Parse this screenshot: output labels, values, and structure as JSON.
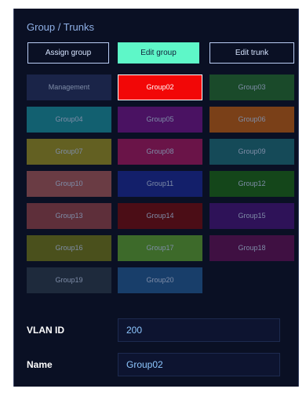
{
  "panel": {
    "title": "Group / Trunks"
  },
  "modes": {
    "assign_label": "Assign group",
    "edit_label": "Edit group",
    "trunk_label": "Edit trunk",
    "active": "Edit group"
  },
  "groups": [
    {
      "label": "Management",
      "color": "#1a2448",
      "selected": false
    },
    {
      "label": "Group02",
      "color": "#f20707",
      "selected": true
    },
    {
      "label": "Group03",
      "color": "#1a4a2a",
      "selected": false
    },
    {
      "label": "Group04",
      "color": "#126070",
      "selected": false
    },
    {
      "label": "Group05",
      "color": "#4a1262",
      "selected": false
    },
    {
      "label": "Group06",
      "color": "#7a4018",
      "selected": false
    },
    {
      "label": "Group07",
      "color": "#636022",
      "selected": false
    },
    {
      "label": "Group08",
      "color": "#6a1448",
      "selected": false
    },
    {
      "label": "Group09",
      "color": "#154a58",
      "selected": false
    },
    {
      "label": "Group10",
      "color": "#6a3c44",
      "selected": false
    },
    {
      "label": "Group11",
      "color": "#131f6a",
      "selected": false
    },
    {
      "label": "Group12",
      "color": "#14461a",
      "selected": false
    },
    {
      "label": "Group13",
      "color": "#5e2f3a",
      "selected": false
    },
    {
      "label": "Group14",
      "color": "#4b0d16",
      "selected": false
    },
    {
      "label": "Group15",
      "color": "#2e1258",
      "selected": false
    },
    {
      "label": "Group16",
      "color": "#4a501c",
      "selected": false
    },
    {
      "label": "Group17",
      "color": "#3d6a2a",
      "selected": false
    },
    {
      "label": "Group18",
      "color": "#3f1042",
      "selected": false
    },
    {
      "label": "Group19",
      "color": "#1e2a3c",
      "selected": false
    },
    {
      "label": "Group20",
      "color": "#183e6a",
      "selected": false
    }
  ],
  "fields": {
    "vlan_label": "VLAN ID",
    "vlan_value": "200",
    "name_label": "Name",
    "name_value": "Group02"
  }
}
